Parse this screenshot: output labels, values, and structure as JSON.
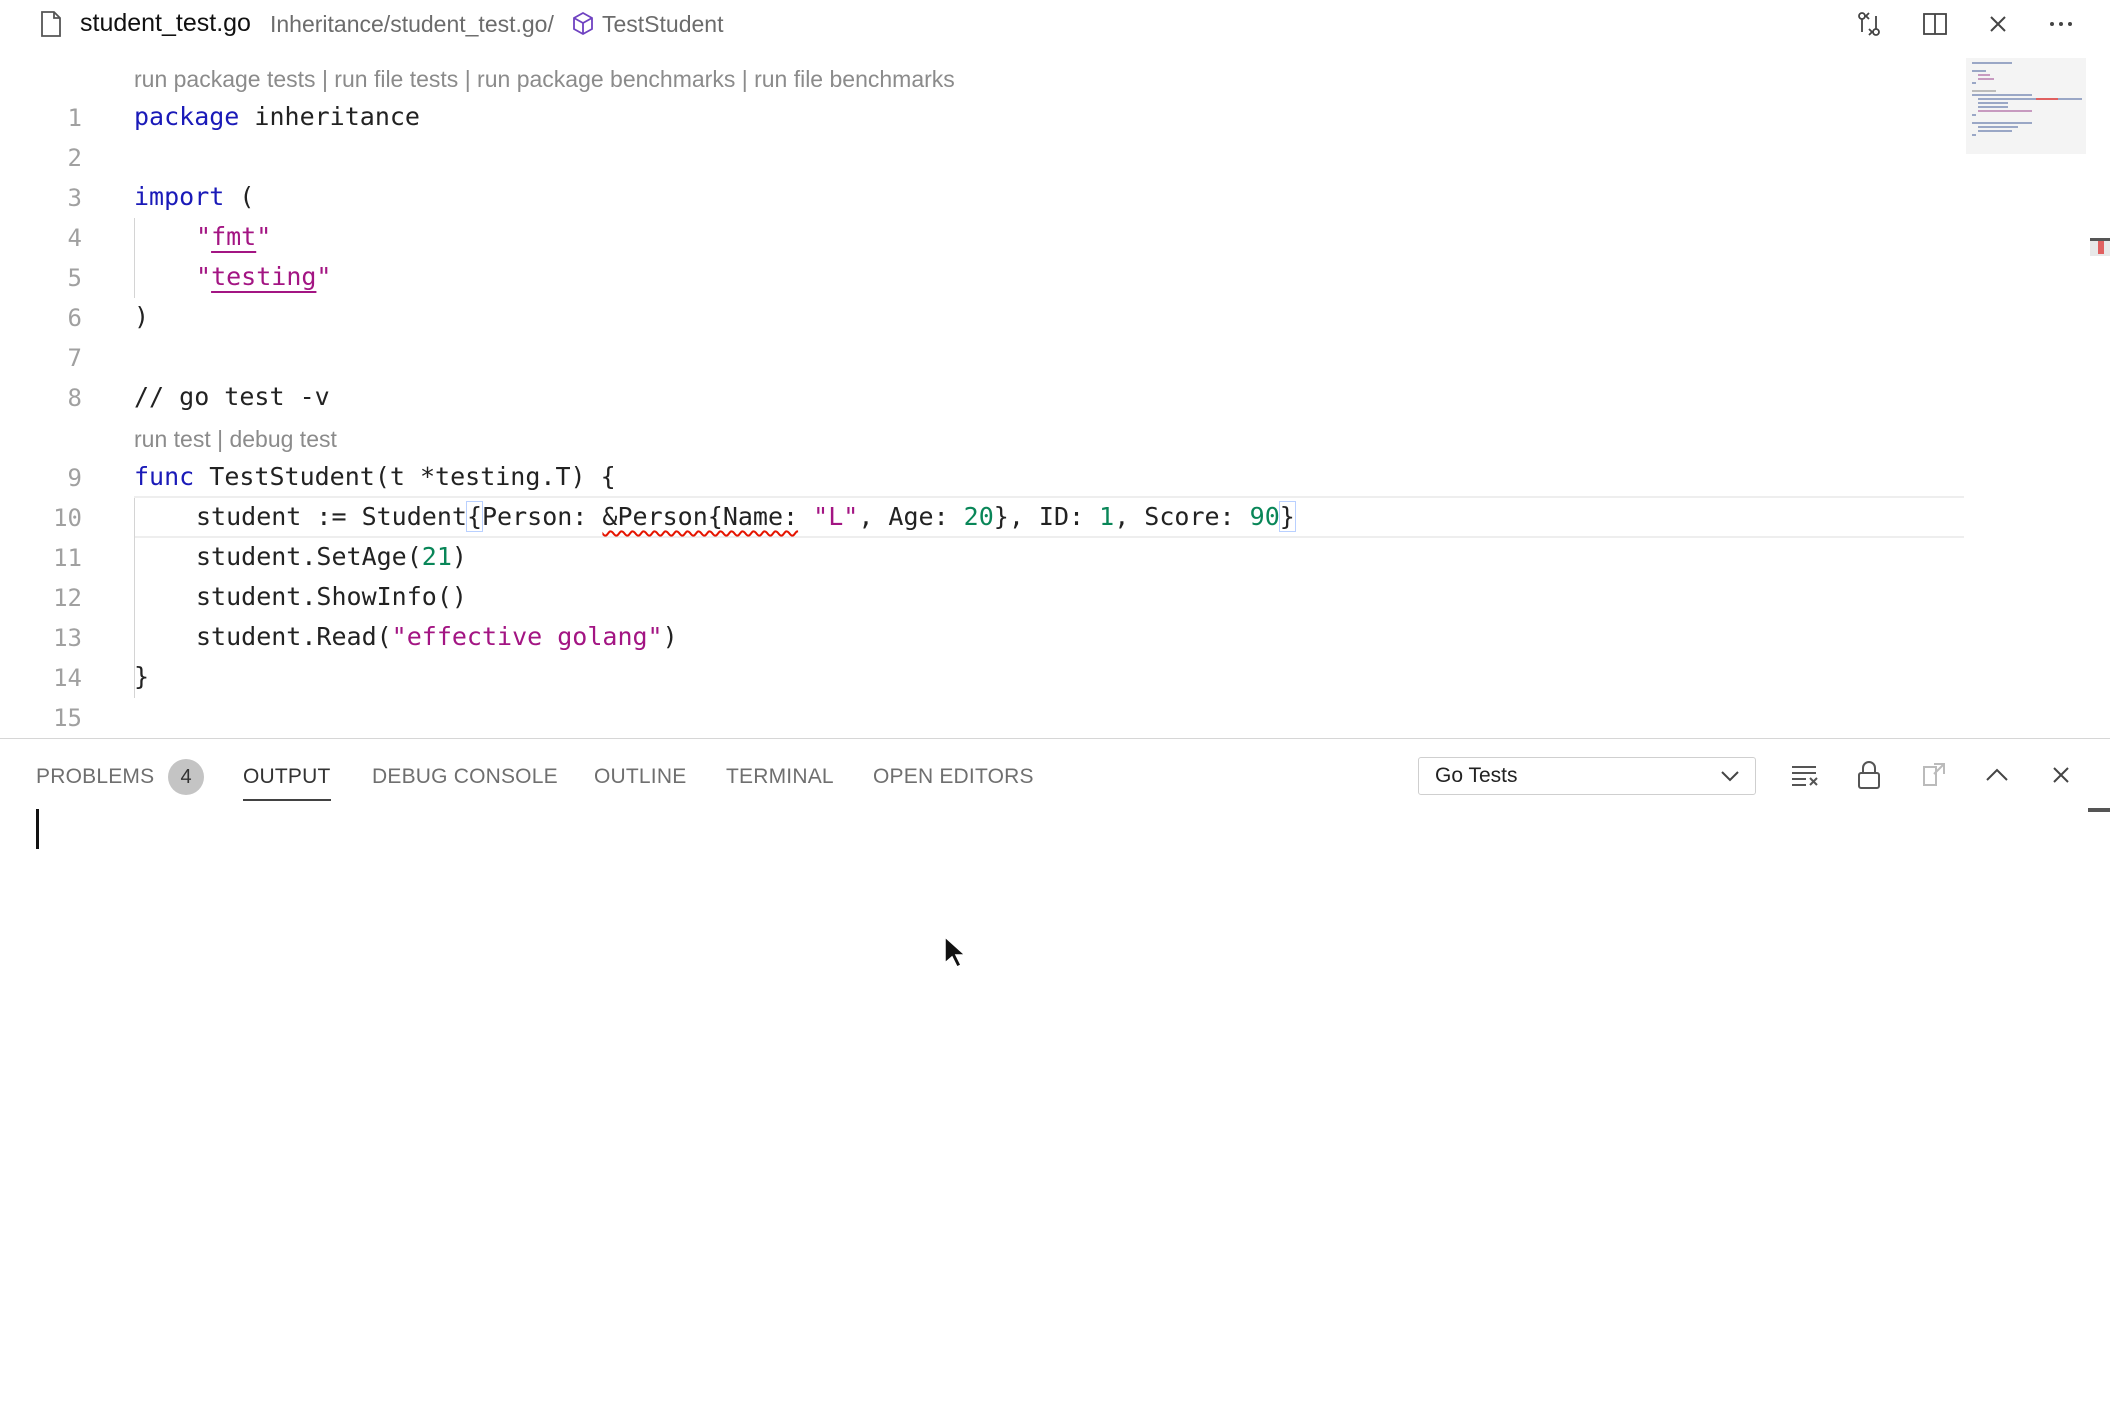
{
  "titlebar": {
    "file_name": "student_test.go",
    "path": "Inheritance/student_test.go/",
    "symbol": "TestStudent",
    "icons": [
      "file-icon",
      "symbol-method-icon",
      "open-changes-icon",
      "split-editor-icon",
      "close-icon",
      "more-actions-icon"
    ]
  },
  "editor": {
    "codelens_top": "run package tests | run file tests | run package benchmarks | run file benchmarks",
    "codelens_func": "run test | debug test",
    "line_numbers": [
      "1",
      "2",
      "3",
      "4",
      "5",
      "6",
      "7",
      "8",
      "9",
      "10",
      "11",
      "12",
      "13",
      "14",
      "15"
    ],
    "lines": {
      "l1_kw": "package",
      "l1_rest": " inheritance",
      "l3_kw": "import",
      "l3_rest": " (",
      "l4_q1": "\"",
      "l4_name": "fmt",
      "l4_q2": "\"",
      "l5_q1": "\"",
      "l5_name": "testing",
      "l5_q2": "\"",
      "l6": ")",
      "l8": "// go test -v",
      "l9_kw": "func",
      "l9_rest": " TestStudent(t *testing.T) {",
      "l10_a": "student := Student",
      "l10_brace_open": "{",
      "l10_b": "Person: ",
      "l10_err": "&Person{Name:",
      "l10_c": " ",
      "l10_str": "\"L\"",
      "l10_d": ", Age: ",
      "l10_n1": "20",
      "l10_e": "}, ID: ",
      "l10_n2": "1",
      "l10_f": ", Score: ",
      "l10_n3": "90",
      "l10_brace_close": "}",
      "l11_a": "student.SetAge(",
      "l11_n": "21",
      "l11_b": ")",
      "l12": "student.ShowInfo()",
      "l13_a": "student.Read(",
      "l13_str": "\"effective golang\"",
      "l13_b": ")",
      "l14": "}"
    },
    "colors": {
      "keyword": "#1a1ab8",
      "string": "#a31583",
      "number": "#098658",
      "error": "#e51400"
    }
  },
  "panel": {
    "tabs": {
      "problems": "PROBLEMS",
      "problems_count": "4",
      "output": "OUTPUT",
      "debug_console": "DEBUG CONSOLE",
      "outline": "OUTLINE",
      "terminal": "TERMINAL",
      "open_editors": "OPEN EDITORS"
    },
    "active_tab": "OUTPUT",
    "output_channel": "Go Tests",
    "icons": [
      "clear-output-icon",
      "lock-scroll-icon",
      "open-log-icon",
      "maximize-panel-icon",
      "close-panel-icon"
    ]
  }
}
